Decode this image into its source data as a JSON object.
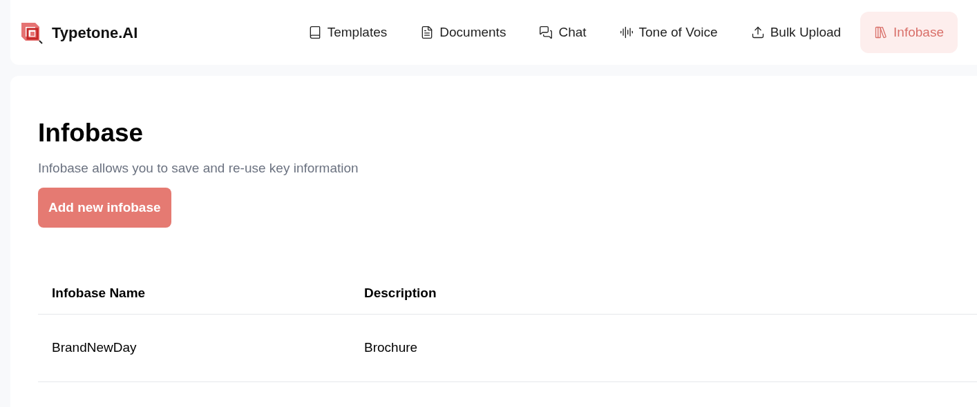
{
  "brand": {
    "name": "Typetone.AI"
  },
  "nav": [
    {
      "kind": "book",
      "label": "Templates",
      "selected": false
    },
    {
      "kind": "document",
      "label": "Documents",
      "selected": false
    },
    {
      "kind": "chat",
      "label": "Chat",
      "selected": false
    },
    {
      "kind": "audio",
      "label": "Tone of Voice",
      "selected": false
    },
    {
      "kind": "upload",
      "label": "Bulk Upload",
      "selected": false
    },
    {
      "kind": "library",
      "label": "Infobase",
      "selected": true
    }
  ],
  "page": {
    "title": "Infobase",
    "subtitle": "Infobase allows you to save and re-use key information",
    "button": "Add new infobase"
  },
  "table": {
    "columns": [
      "Infobase Name",
      "Description"
    ],
    "rows": [
      [
        "BrandNewDay",
        "Brochure"
      ]
    ]
  }
}
